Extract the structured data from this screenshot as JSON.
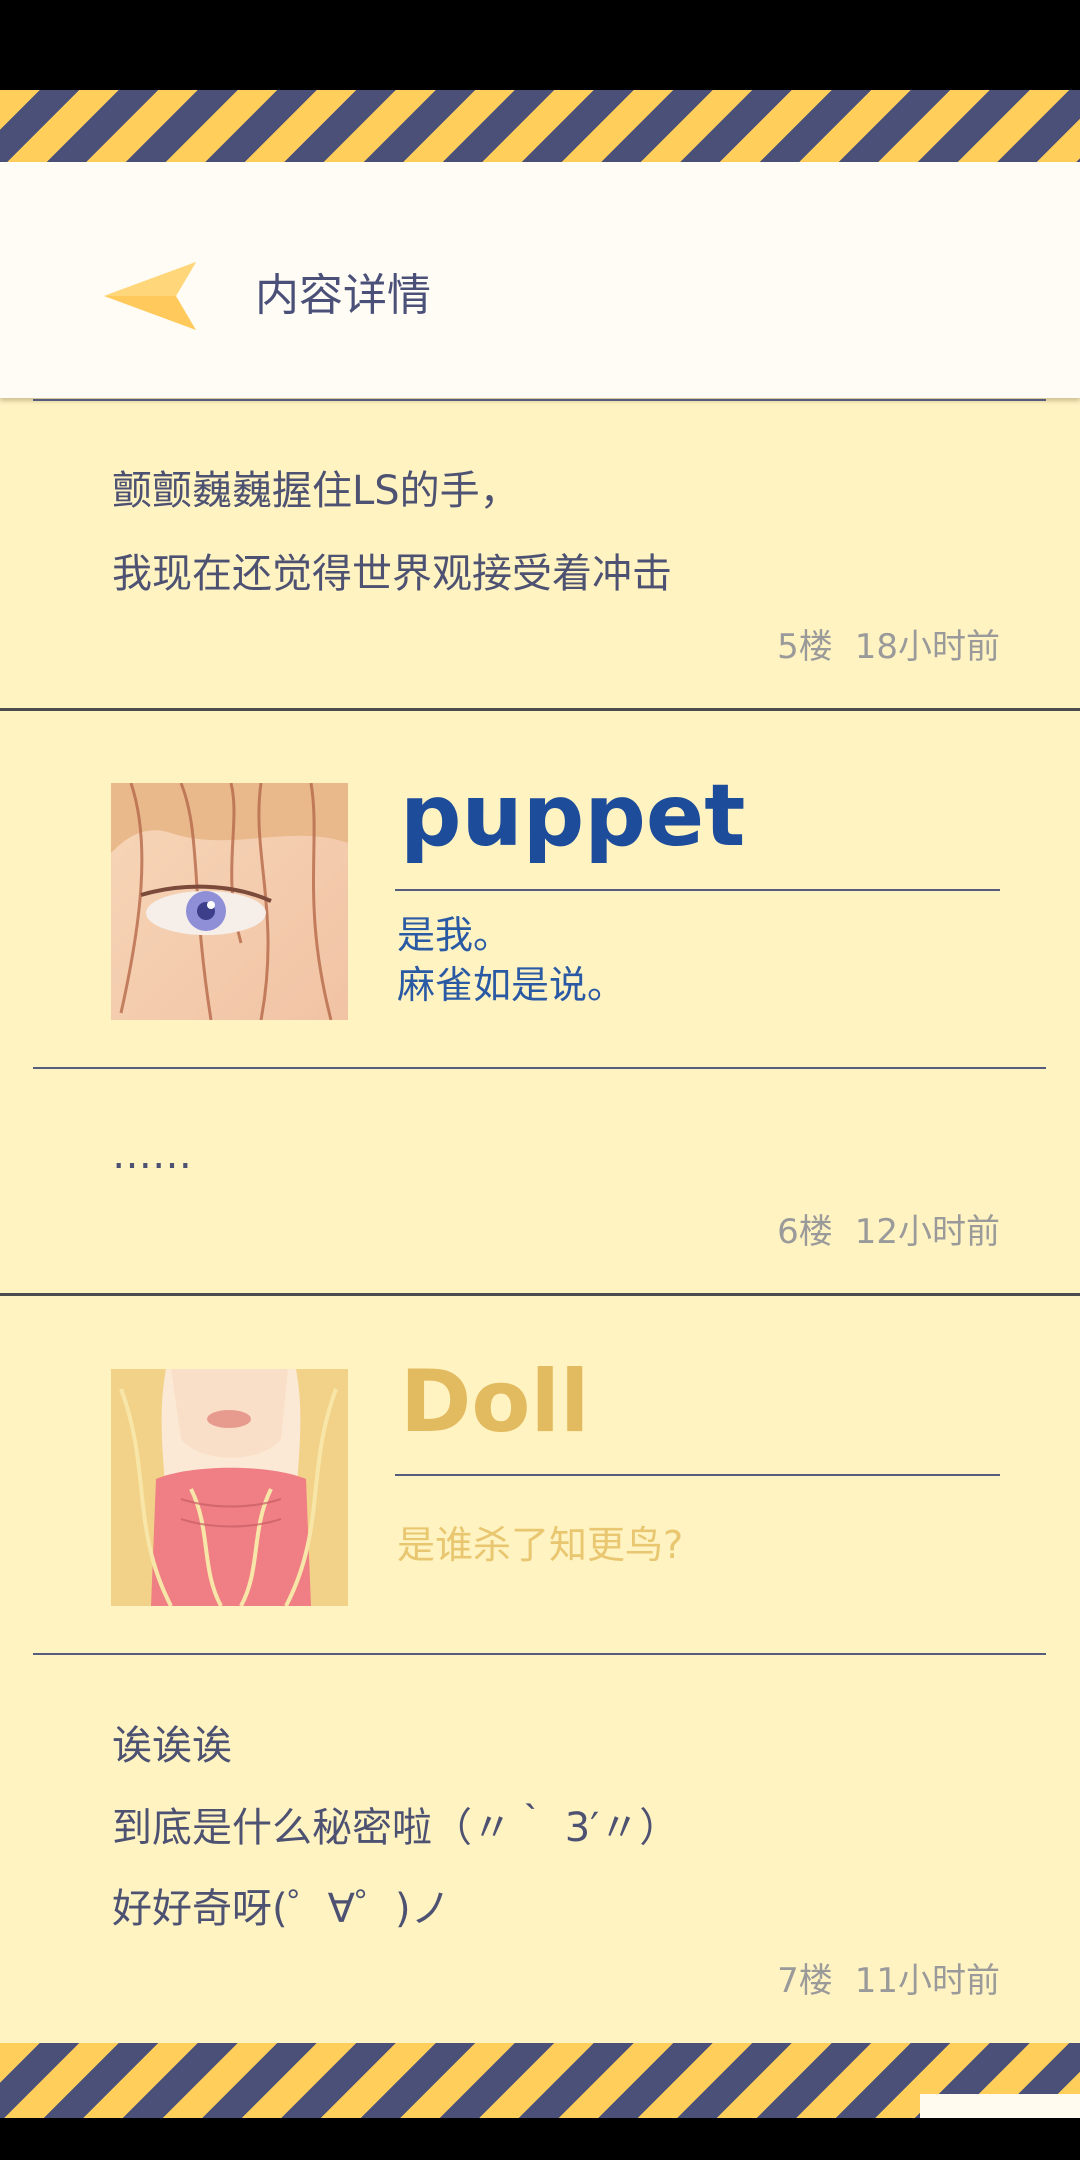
{
  "header": {
    "title": "内容详情"
  },
  "posts": [
    {
      "lines": [
        "颤颤巍巍握住LS的手，",
        "我现在还觉得世界观接受着冲击"
      ],
      "floor": "5楼",
      "time": "18小时前"
    },
    {
      "author": "puppet",
      "quote_lines": [
        "是我。",
        "麻雀如是说。"
      ],
      "lines": [
        "……"
      ],
      "floor": "6楼",
      "time": "12小时前"
    },
    {
      "author": "Doll",
      "quote_lines": [
        "是谁杀了知更鸟?"
      ],
      "lines": [
        "诶诶诶",
        "到底是什么秘密啦（〃｀ 3′〃）",
        "好好奇呀(゜∀゜)ノ"
      ],
      "floor": "7楼",
      "time": "11小时前"
    }
  ],
  "colors": {
    "background": "#fff3c2",
    "stripe_yellow": "#ffce5b",
    "stripe_navy": "#4b5079",
    "text": "#4e5272",
    "puppet_name": "#1d4c9b",
    "doll_name": "#e2ba5f"
  },
  "icons": {
    "back": "back-arrow-icon"
  }
}
